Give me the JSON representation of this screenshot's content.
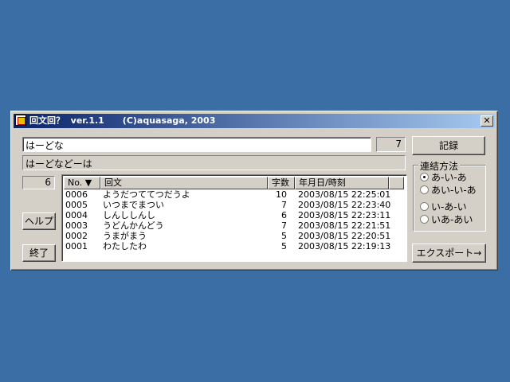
{
  "window": {
    "title": "回文回？  ver.1.1      (C)aquasaga, 2003",
    "close_label": "✕"
  },
  "input": {
    "value": "はーどな",
    "count": "7"
  },
  "result": {
    "value": "はーどなどーは"
  },
  "record_button": "記録",
  "history_count": "6",
  "help_button": "ヘルプ",
  "exit_button": "終了",
  "export_button": "エクスポート→",
  "table": {
    "headers": [
      "No. ▼",
      "回文",
      "字数",
      "年月日/時刻"
    ],
    "rows": [
      {
        "no": "0006",
        "text": "ようだつててつだうよ",
        "len": "10",
        "date": "2003/08/15 22:25:01"
      },
      {
        "no": "0005",
        "text": "いつまでまつい",
        "len": "7",
        "date": "2003/08/15 22:23:40"
      },
      {
        "no": "0004",
        "text": "しんししんし",
        "len": "6",
        "date": "2003/08/15 22:23:11"
      },
      {
        "no": "0003",
        "text": "うどんかんどう",
        "len": "7",
        "date": "2003/08/15 22:21:51"
      },
      {
        "no": "0002",
        "text": "うまがまう",
        "len": "5",
        "date": "2003/08/15 22:20:51"
      },
      {
        "no": "0001",
        "text": "わたしたわ",
        "len": "5",
        "date": "2003/08/15 22:19:13"
      }
    ]
  },
  "join_method": {
    "label": "連結方法",
    "options": [
      "あ-い-あ",
      "あい-い-あ",
      "い-あ-い",
      "いあ-あい"
    ],
    "selected_index": 0
  }
}
